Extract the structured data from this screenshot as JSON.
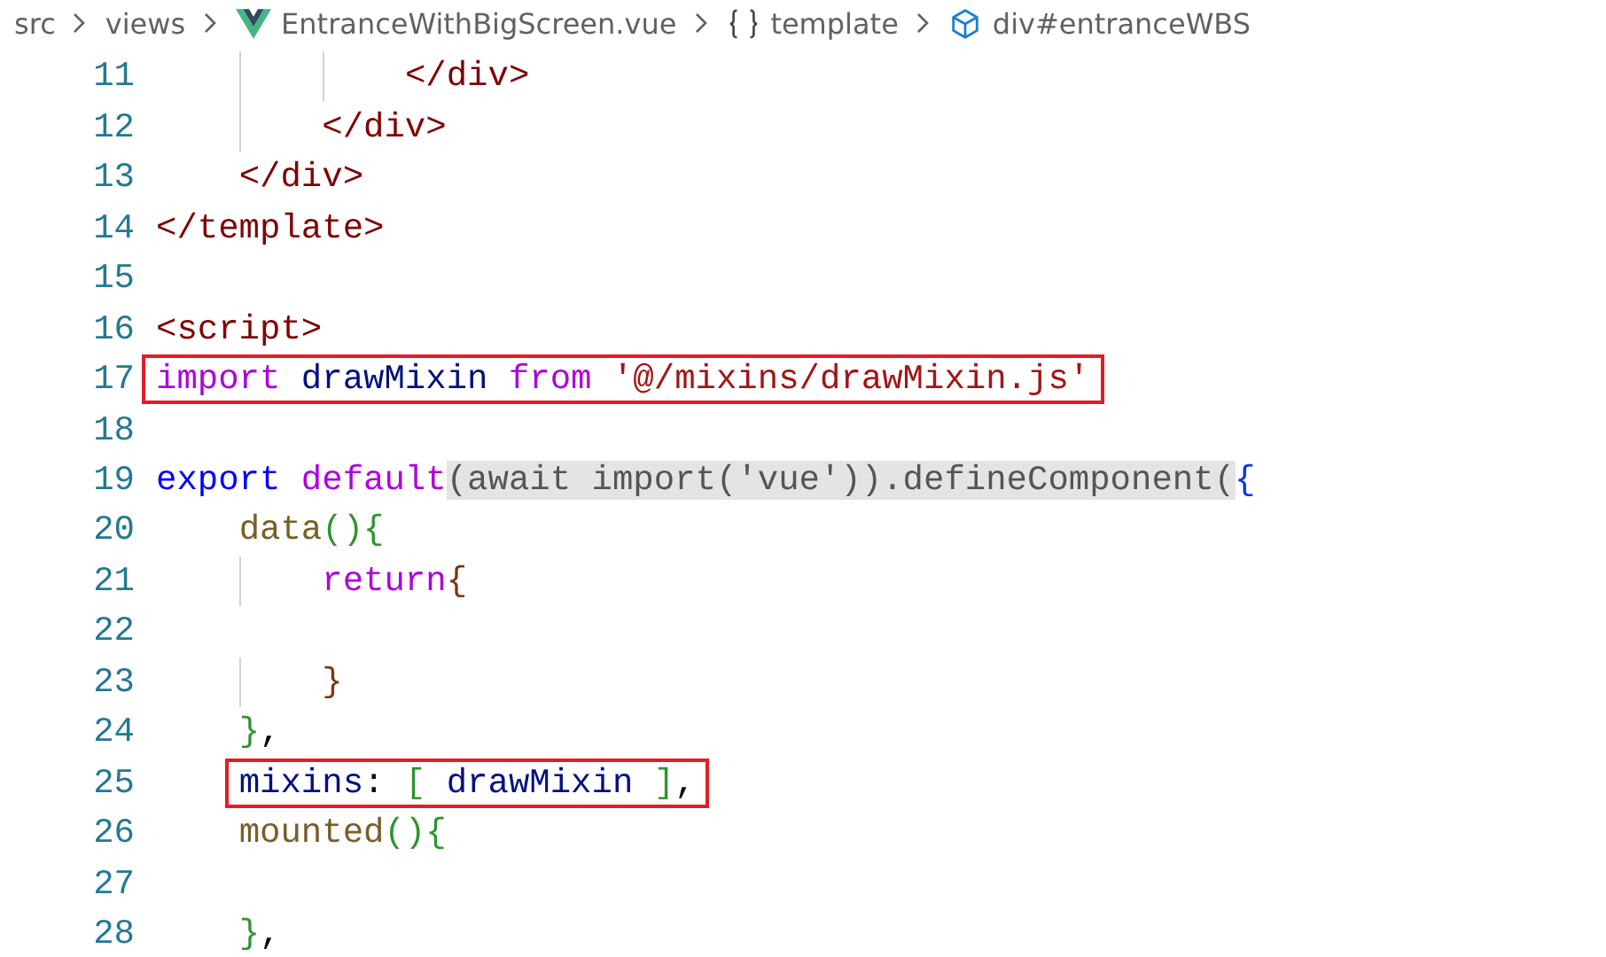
{
  "breadcrumb": [
    {
      "label": "src",
      "kind": "folder"
    },
    {
      "label": "views",
      "kind": "folder"
    },
    {
      "label": "EntranceWithBigScreen.vue",
      "kind": "vue-file"
    },
    {
      "label": "template",
      "kind": "template"
    },
    {
      "label": "div#entranceWBS",
      "kind": "element"
    }
  ],
  "lines": [
    {
      "number": "11",
      "boxed": false,
      "tokens": [
        {
          "text": "            </div>",
          "kind": "tag"
        }
      ]
    },
    {
      "number": "12",
      "boxed": false,
      "tokens": [
        {
          "text": "        </div>",
          "kind": "tag"
        }
      ]
    },
    {
      "number": "13",
      "boxed": false,
      "tokens": [
        {
          "text": "    </div>",
          "kind": "tag"
        }
      ]
    },
    {
      "number": "14",
      "boxed": false,
      "tokens": [
        {
          "text": "</template>",
          "kind": "tag"
        }
      ]
    },
    {
      "number": "15",
      "boxed": false
    },
    {
      "number": "16",
      "boxed": false,
      "tokens": [
        {
          "text": "<script>",
          "kind": "tag"
        }
      ]
    },
    {
      "number": "17",
      "boxed": true,
      "tokens": [
        {
          "text": "import",
          "kind": "control"
        },
        {
          "text": " drawMixin ",
          "kind": "variable"
        },
        {
          "text": "from",
          "kind": "control"
        },
        {
          "text": " '@/mixins/drawMixin.js'",
          "kind": "string"
        }
      ]
    },
    {
      "number": "18",
      "boxed": false
    },
    {
      "number": "19",
      "boxed": false,
      "tokens": [
        {
          "text": "export ",
          "kind": "keyword"
        },
        {
          "text": "default",
          "kind": "control"
        },
        {
          "text": "(await import('vue')).defineComponent(",
          "kind": "dim",
          "shaded": true
        },
        {
          "text": "{",
          "kind": "bracket1"
        }
      ]
    },
    {
      "number": "20",
      "boxed": false,
      "tokens": [
        {
          "text": "    data",
          "kind": "func"
        },
        {
          "text": "(){",
          "kind": "bracket2"
        }
      ]
    },
    {
      "number": "21",
      "boxed": false,
      "tokens": [
        {
          "text": "        return",
          "kind": "control"
        },
        {
          "text": "{",
          "kind": "bracket3"
        }
      ]
    },
    {
      "number": "22",
      "boxed": false
    },
    {
      "number": "23",
      "boxed": false,
      "tokens": [
        {
          "text": "        }",
          "kind": "bracket3"
        }
      ]
    },
    {
      "number": "24",
      "boxed": false,
      "tokens": [
        {
          "text": "    }",
          "kind": "bracket2"
        },
        {
          "text": ",",
          "kind": "plain"
        }
      ]
    },
    {
      "number": "25",
      "boxed": true,
      "tokens": [
        {
          "text": "    mixins",
          "kind": "property"
        },
        {
          "text": ": ",
          "kind": "plain"
        },
        {
          "text": "[",
          "kind": "bracket2"
        },
        {
          "text": " drawMixin ",
          "kind": "variable"
        },
        {
          "text": "]",
          "kind": "bracket2"
        },
        {
          "text": ",",
          "kind": "plain"
        }
      ]
    },
    {
      "number": "26",
      "boxed": false,
      "tokens": [
        {
          "text": "    mounted",
          "kind": "func"
        },
        {
          "text": "(){",
          "kind": "bracket2"
        }
      ]
    },
    {
      "number": "27",
      "boxed": false
    },
    {
      "number": "28",
      "boxed": false,
      "tokens": [
        {
          "text": "    }",
          "kind": "bracket2"
        },
        {
          "text": ",",
          "kind": "plain"
        }
      ]
    }
  ]
}
